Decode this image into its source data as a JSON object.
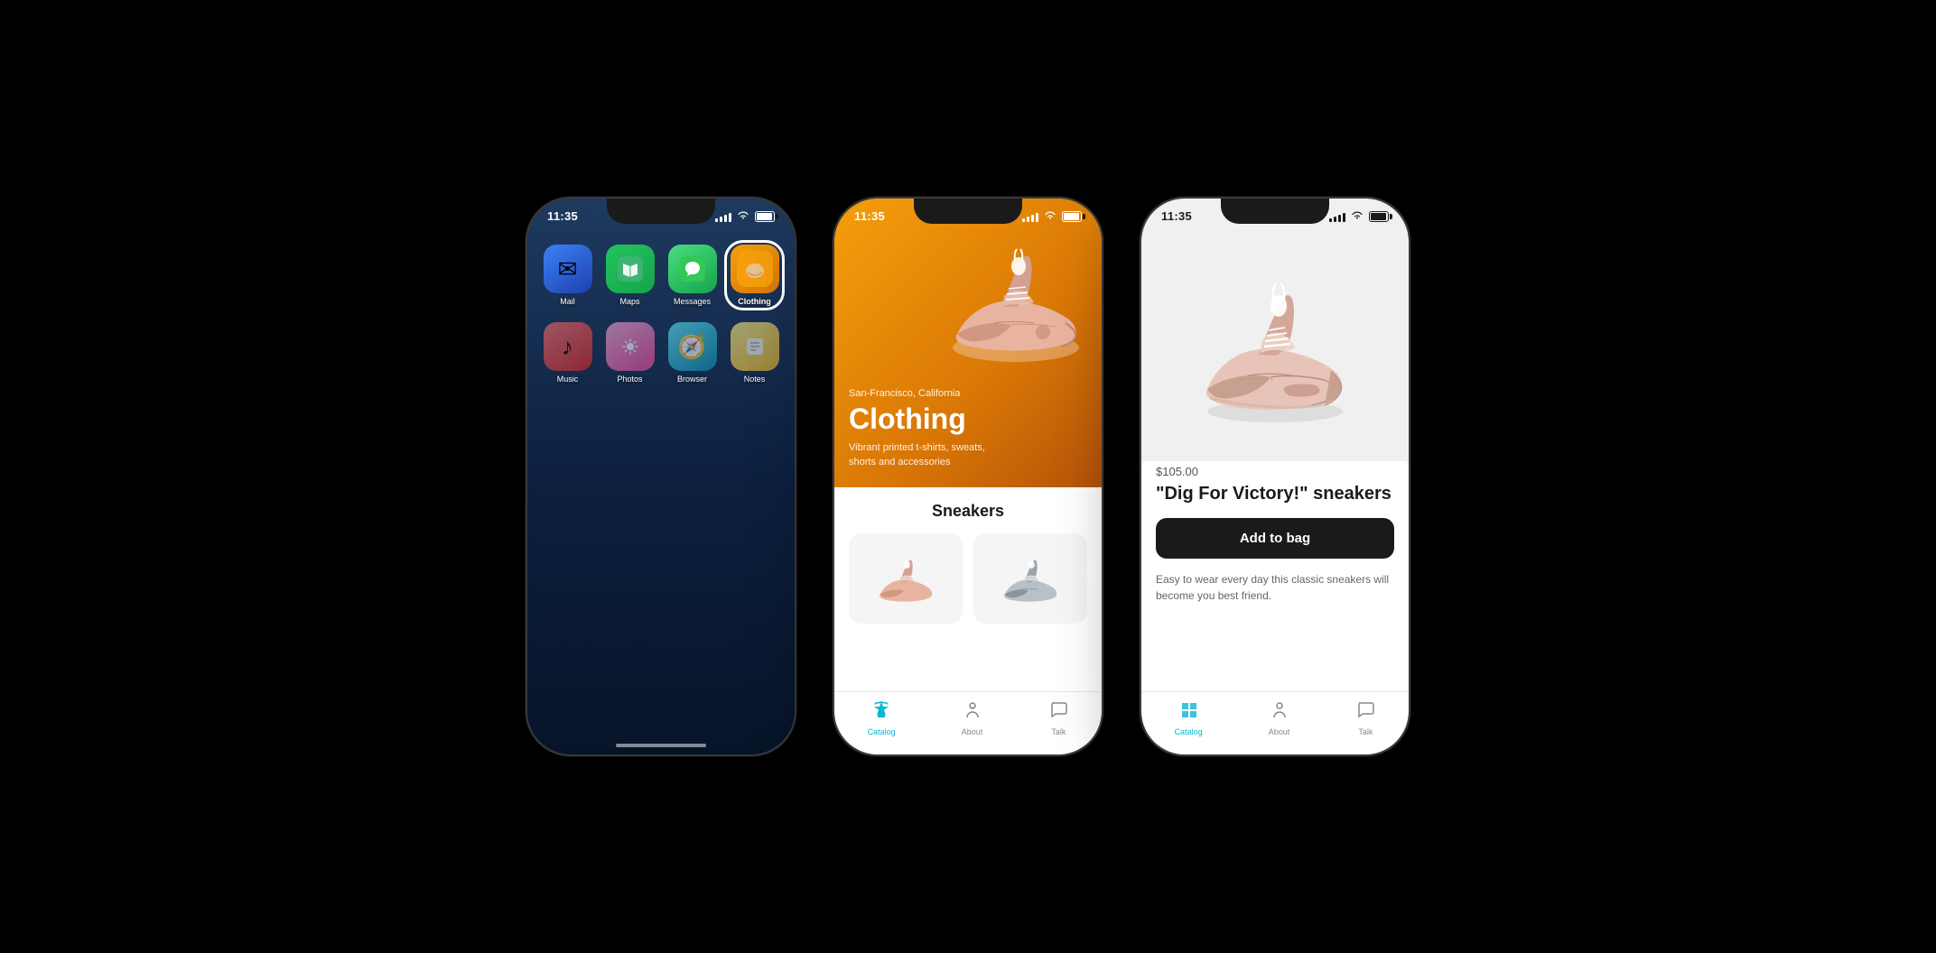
{
  "phones": {
    "home": {
      "time": "11:35",
      "apps": [
        {
          "id": "mail",
          "label": "Mail",
          "icon": "✉",
          "class": "mail-icon"
        },
        {
          "id": "maps",
          "label": "Maps",
          "icon": "🗺",
          "class": "maps-icon"
        },
        {
          "id": "messages",
          "label": "Messages",
          "icon": "💬",
          "class": "messages-icon"
        },
        {
          "id": "clothing",
          "label": "Clothing",
          "icon": "👟",
          "class": "clothing-icon"
        },
        {
          "id": "music",
          "label": "Music",
          "icon": "♪",
          "class": "music-icon"
        },
        {
          "id": "photos",
          "label": "Photos",
          "icon": "🌸",
          "class": "photos-icon"
        },
        {
          "id": "browser",
          "label": "Browser",
          "icon": "🧭",
          "class": "browser-icon"
        },
        {
          "id": "notes",
          "label": "Notes",
          "icon": "📄",
          "class": "notes-icon"
        }
      ]
    },
    "catalog": {
      "time": "11:35",
      "hero": {
        "location": "San-Francisco, California",
        "title": "Clothing",
        "subtitle": "Vibrant printed t-shirts, sweats, shorts and accessories"
      },
      "section_title": "Sneakers",
      "tabs": [
        {
          "id": "catalog",
          "label": "Catalog",
          "active": true
        },
        {
          "id": "about",
          "label": "About",
          "active": false
        },
        {
          "id": "talk",
          "label": "Talk",
          "active": false
        }
      ]
    },
    "product": {
      "time": "11:35",
      "price": "$105.00",
      "name": "\"Dig For Victory!\" sneakers",
      "add_to_bag": "Add to bag",
      "description": "Easy to wear every day this classic sneakers will become you best friend.",
      "tabs": [
        {
          "id": "catalog",
          "label": "Catalog",
          "active": true
        },
        {
          "id": "about",
          "label": "About",
          "active": false
        },
        {
          "id": "talk",
          "label": "Talk",
          "active": false
        }
      ]
    }
  },
  "colors": {
    "accent": "#06b6d4",
    "dark": "#1a1a1a",
    "hero_bg": "#f59e0b"
  }
}
